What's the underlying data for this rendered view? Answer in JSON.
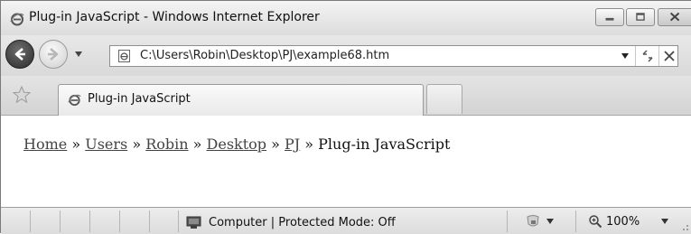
{
  "window": {
    "title": "Plug-in JavaScript - Windows Internet Explorer"
  },
  "address_bar": {
    "url": "C:\\Users\\Robin\\Desktop\\PJ\\example68.htm"
  },
  "tabs": [
    {
      "label": "Plug-in JavaScript",
      "active": true
    }
  ],
  "breadcrumb": {
    "items": [
      {
        "label": "Home",
        "link": true
      },
      {
        "label": "Users",
        "link": true
      },
      {
        "label": "Robin",
        "link": true
      },
      {
        "label": "Desktop",
        "link": true
      },
      {
        "label": "PJ",
        "link": true
      },
      {
        "label": "Plug-in JavaScript",
        "link": false
      }
    ],
    "separator": "»"
  },
  "status_bar": {
    "zone_text": "Computer | Protected Mode: Off",
    "zoom": "100%"
  },
  "colors": {
    "link": "#444444",
    "chrome": "#e4e4e4",
    "ie_icon": "#3b6ea8"
  }
}
